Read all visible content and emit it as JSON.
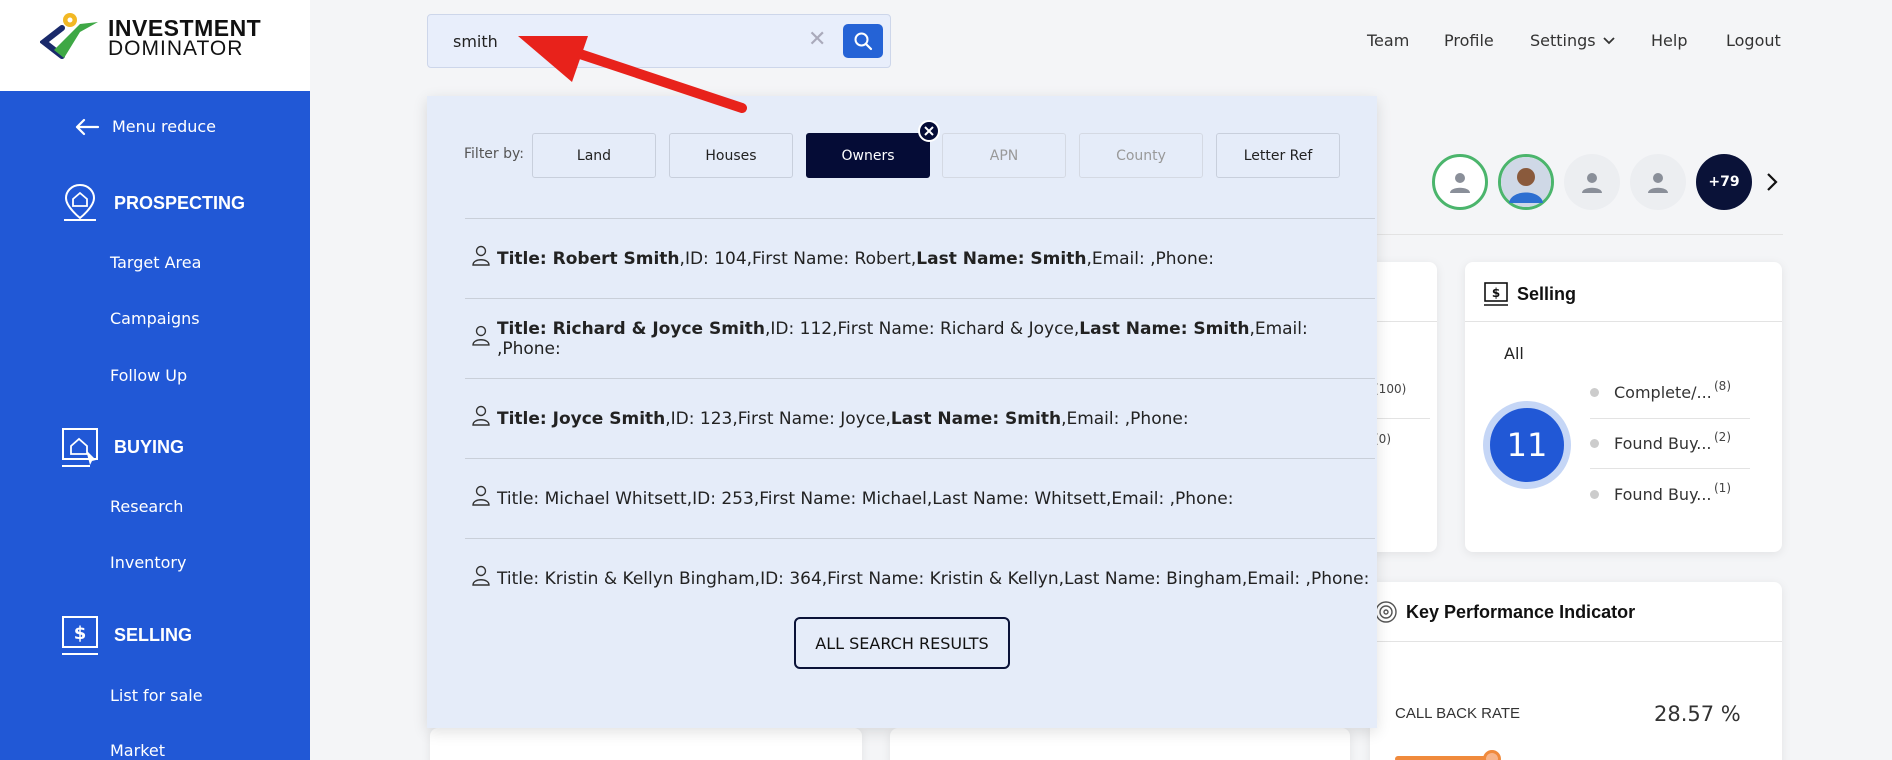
{
  "logo": {
    "line1": "INVESTMENT",
    "line2": "DOMINATOR"
  },
  "sidebar": {
    "menu_reduce": "Menu reduce",
    "sections": [
      {
        "title": "PROSPECTING",
        "items": [
          "Target Area",
          "Campaigns",
          "Follow Up"
        ]
      },
      {
        "title": "BUYING",
        "items": [
          "Research",
          "Inventory"
        ]
      },
      {
        "title": "SELLING",
        "items": [
          "List for sale",
          "Market"
        ]
      }
    ]
  },
  "search": {
    "value": "smith",
    "clear": "✕"
  },
  "topnav": {
    "team": "Team",
    "profile": "Profile",
    "settings": "Settings",
    "help": "Help",
    "logout": "Logout"
  },
  "avatars": {
    "more_label": "+79"
  },
  "selling_card": {
    "title": "Selling",
    "filter": "All",
    "total": "11",
    "legend": [
      {
        "label": "Complete/...",
        "count": "(8)"
      },
      {
        "label": "Found Buy...",
        "count": "(2)"
      },
      {
        "label": "Found Buy...",
        "count": "(1)"
      }
    ]
  },
  "left_card_partial": {
    "count1": "(100)",
    "count2": "(0)"
  },
  "kpi_card": {
    "title": "Key Performance Indicator",
    "metric_label": "CALL BACK RATE",
    "metric_value": "28.57 %"
  },
  "dropdown": {
    "filter_label": "Filter by:",
    "filters": [
      {
        "label": "Land",
        "state": "normal"
      },
      {
        "label": "Houses",
        "state": "normal"
      },
      {
        "label": "Owners",
        "state": "active"
      },
      {
        "label": "APN",
        "state": "muted"
      },
      {
        "label": "County",
        "state": "muted"
      },
      {
        "label": "Letter Ref",
        "state": "normal"
      }
    ],
    "results": [
      {
        "title": "Robert Smith",
        "id": "104",
        "first": "Robert",
        "last": "Smith",
        "bold": true
      },
      {
        "title": "Richard & Joyce Smith",
        "id": "112",
        "first": "Richard & Joyce",
        "last": "Smith",
        "bold": true
      },
      {
        "title": "Joyce Smith",
        "id": "123",
        "first": "Joyce",
        "last": "Smith",
        "bold": true
      },
      {
        "title": "Michael Whitsett",
        "id": "253",
        "first": "Michael",
        "last": "Whitsett",
        "bold": false
      },
      {
        "title": "Kristin & Kellyn Bingham",
        "id": "364",
        "first": "Kristin & Kellyn",
        "last": "Bingham",
        "bold": false
      }
    ],
    "all_results_label": "ALL SEARCH RESULTS"
  },
  "colors": {
    "sidebar": "#2158d6",
    "active_chip": "#050c36",
    "arrow": "#e8221b",
    "accent_green": "#4bb56c"
  }
}
